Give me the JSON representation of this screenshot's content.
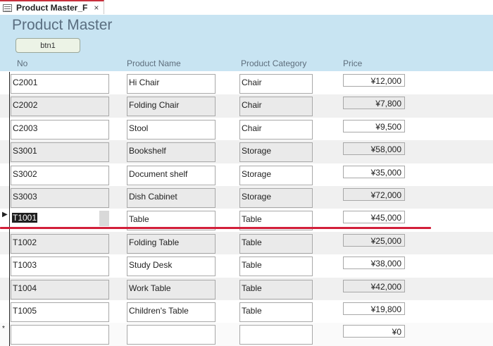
{
  "tab": {
    "title": "Product Master_F",
    "close": "×"
  },
  "header": {
    "title": "Product Master",
    "button_label": "btn1",
    "columns": {
      "no": "No",
      "name": "Product Name",
      "category": "Product Category",
      "price": "Price"
    }
  },
  "rows": [
    {
      "no": "C2001",
      "name": "Hi Chair",
      "category": "Chair",
      "price": "¥12,000"
    },
    {
      "no": "C2002",
      "name": "Folding Chair",
      "category": "Chair",
      "price": "¥7,800"
    },
    {
      "no": "C2003",
      "name": "Stool",
      "category": "Chair",
      "price": "¥9,500"
    },
    {
      "no": "S3001",
      "name": "Bookshelf",
      "category": "Storage",
      "price": "¥58,000"
    },
    {
      "no": "S3002",
      "name": "Document shelf",
      "category": "Storage",
      "price": "¥35,000"
    },
    {
      "no": "S3003",
      "name": "Dish Cabinet",
      "category": "Storage",
      "price": "¥72,000"
    },
    {
      "no": "T1001",
      "name": "Table",
      "category": "Table",
      "price": "¥45,000"
    },
    {
      "no": "T1002",
      "name": "Folding Table",
      "category": "Table",
      "price": "¥25,000"
    },
    {
      "no": "T1003",
      "name": "Study Desk",
      "category": "Table",
      "price": "¥38,000"
    },
    {
      "no": "T1004",
      "name": "Work Table",
      "category": "Table",
      "price": "¥42,000"
    },
    {
      "no": "T1005",
      "name": "Children's Table",
      "category": "Table",
      "price": "¥19,800"
    }
  ],
  "new_row": {
    "marker": "*",
    "price": "¥0"
  },
  "current_row_marker": "▶",
  "colors": {
    "header_bg": "#c8e4f2",
    "accent_red": "#d21f3a",
    "alt_row": "#f0f0f0"
  }
}
